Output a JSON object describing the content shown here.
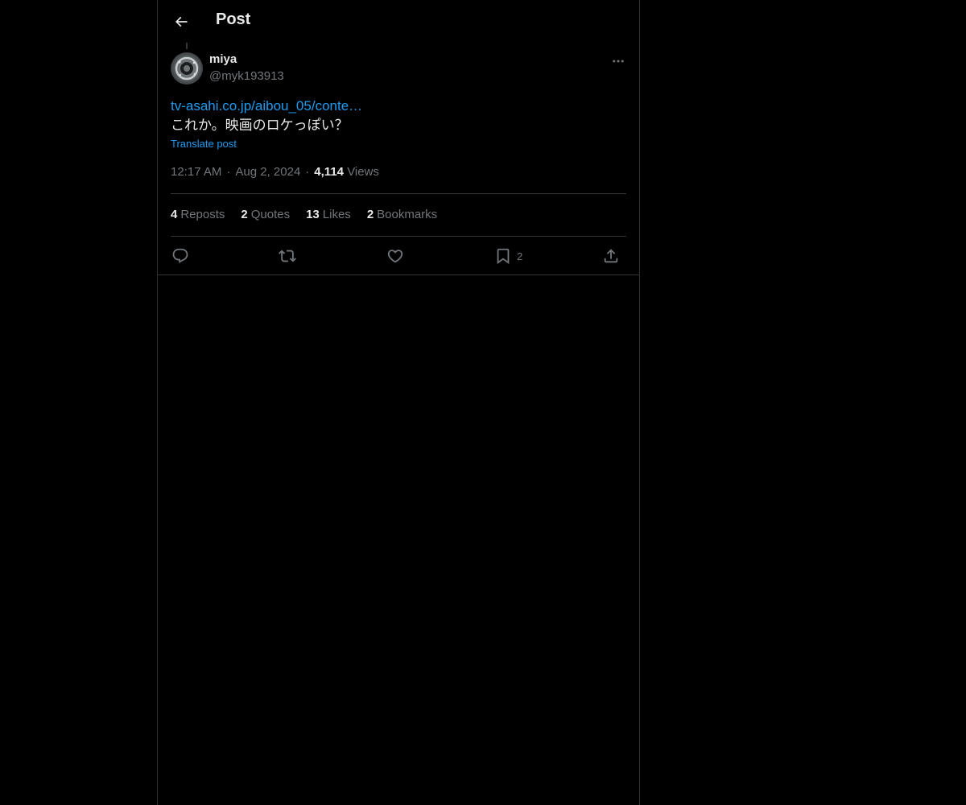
{
  "header": {
    "back_icon": "arrow-left-icon",
    "title": "Post"
  },
  "post": {
    "author": {
      "name": "miya",
      "handle": "@myk193913",
      "avatar_icon": "avatar-image"
    },
    "more_icon": "more-horizontal-icon",
    "link_text": "tv-asahi.co.jp/aibou_05/conte…",
    "text": "これか。映画のロケっぽい？",
    "translate_label": "Translate post",
    "time": "12:17 AM",
    "separator": "·",
    "date": "Aug 2, 2024",
    "views_count": "4,114",
    "views_label": "Views"
  },
  "stats": [
    {
      "count": "4",
      "label": "Reposts"
    },
    {
      "count": "2",
      "label": "Quotes"
    },
    {
      "count": "13",
      "label": "Likes"
    },
    {
      "count": "2",
      "label": "Bookmarks"
    }
  ],
  "actions": {
    "reply": {
      "icon": "reply-icon",
      "count": ""
    },
    "repost": {
      "icon": "repost-icon",
      "count": ""
    },
    "like": {
      "icon": "heart-icon",
      "count": ""
    },
    "bookmark": {
      "icon": "bookmark-icon",
      "count": "2"
    },
    "share": {
      "icon": "share-icon",
      "count": ""
    }
  },
  "colors": {
    "background": "#000000",
    "text": "#e7e9ea",
    "secondary": "#71767b",
    "accent": "#1d9bf0",
    "border": "#2f3336"
  }
}
